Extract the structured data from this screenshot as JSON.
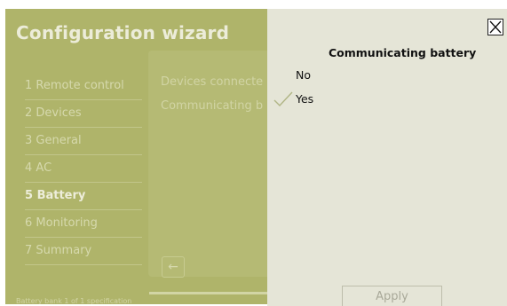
{
  "wizard": {
    "title": "Configuration wizard",
    "steps": [
      {
        "label": "1 Remote control"
      },
      {
        "label": "2 Devices"
      },
      {
        "label": "3 General"
      },
      {
        "label": "4 AC"
      },
      {
        "label": "5 Battery"
      },
      {
        "label": "6 Monitoring"
      },
      {
        "label": "7 Summary"
      }
    ],
    "active_step": "5 Battery",
    "content": {
      "devices_connected_label": "Devices connecte",
      "communicating_label": "Communicating b"
    },
    "back_icon": "arrow-left-icon",
    "footer": "Battery bank 1 of 1 specification"
  },
  "panel": {
    "close_icon": "close-icon",
    "title": "Communicating battery",
    "options": [
      {
        "label": "No",
        "selected": false
      },
      {
        "label": "Yes",
        "selected": true
      }
    ],
    "check_icon": "checkmark-icon",
    "apply_label": "Apply"
  },
  "colors": {
    "wizard_bg": "#afb46a",
    "panel_bg": "#e5e5d7",
    "check": "#b0b585"
  }
}
